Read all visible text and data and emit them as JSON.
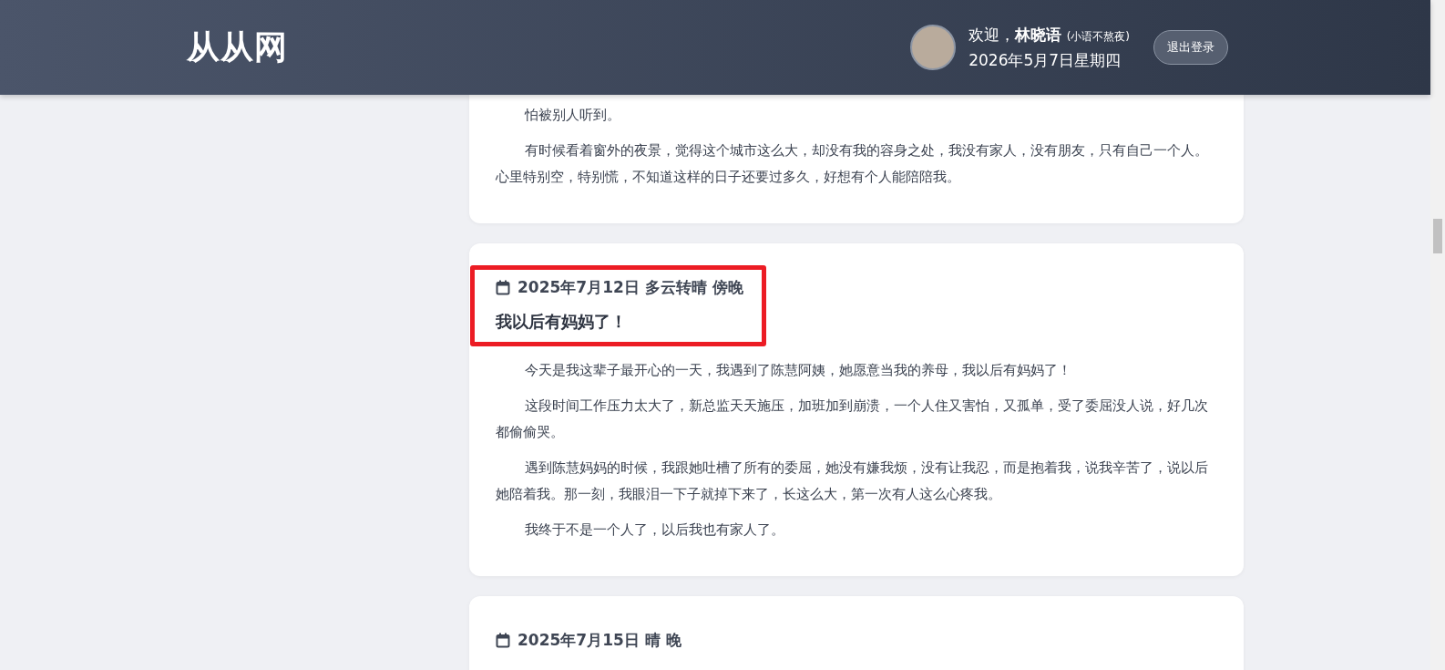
{
  "header": {
    "logo": "从从网",
    "welcome": "欢迎，",
    "user_name": "林晓语",
    "nickname": "(小语不熬夜)",
    "date": "2026年5月7日星期四",
    "logout_button": "退出登录"
  },
  "entries": [
    {
      "paragraphs": [
        "怕被别人听到。",
        "有时候看着窗外的夜景，觉得这个城市这么大，却没有我的容身之处，我没有家人，没有朋友，只有自己一个人。心里特别空，特别慌，不知道这样的日子还要过多久，好想有个人能陪陪我。"
      ]
    },
    {
      "date_line": "2025年7月12日 多云转晴 傍晚",
      "title": "我以后有妈妈了！",
      "highlighted": true,
      "paragraphs": [
        "今天是我这辈子最开心的一天，我遇到了陈慧阿姨，她愿意当我的养母，我以后有妈妈了！",
        "这段时间工作压力太大了，新总监天天施压，加班加到崩溃，一个人住又害怕，又孤单，受了委屈没人说，好几次都偷偷哭。",
        "遇到陈慧妈妈的时候，我跟她吐槽了所有的委屈，她没有嫌我烦，没有让我忍，而是抱着我，说我辛苦了，说以后她陪着我。那一刻，我眼泪一下子就掉下来了，长这么大，第一次有人这么心疼我。",
        "我终于不是一个人了，以后我也有家人了。"
      ]
    },
    {
      "date_line": "2025年7月15日 晴 晚",
      "highlighted": false
    }
  ]
}
